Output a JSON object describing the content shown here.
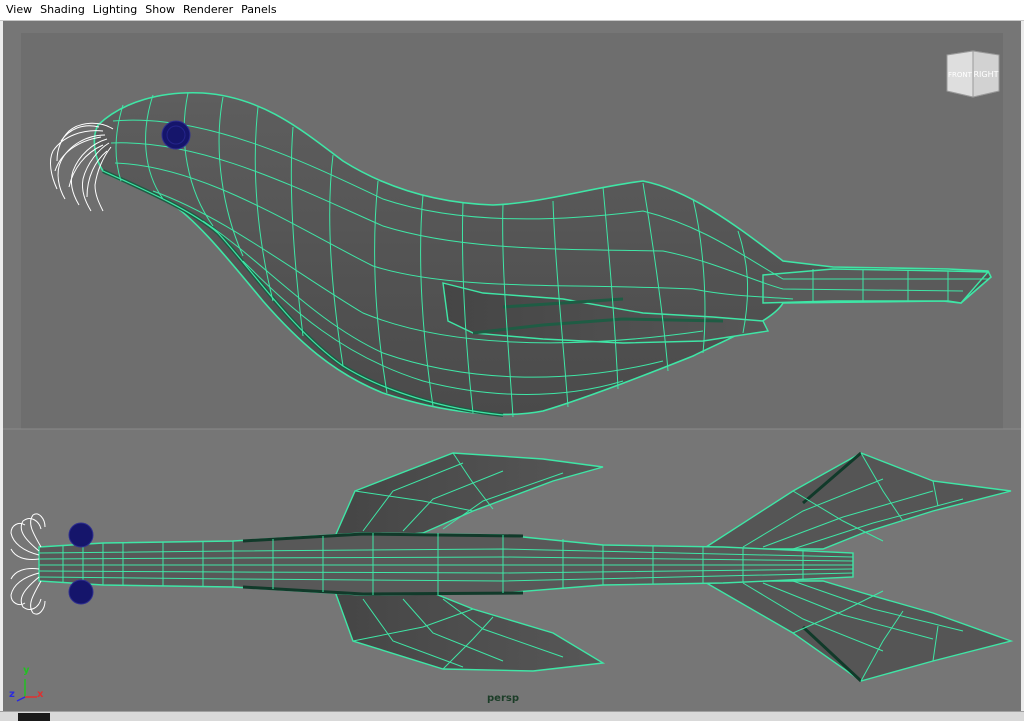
{
  "menu": {
    "items": [
      "View",
      "Shading",
      "Lighting",
      "Show",
      "Renderer",
      "Panels"
    ]
  },
  "viewcube": {
    "front_label": "FRONT",
    "right_label": "RIGHT"
  },
  "viewport": {
    "camera_label": "persp",
    "background_color": "#767676",
    "wire_color": "#3fe6a6",
    "eye_color": "#15156b"
  },
  "axis": {
    "x_label": "x",
    "y_label": "y",
    "z_label": "z",
    "x_color": "#e03030",
    "y_color": "#22c022",
    "z_color": "#2a2ae0"
  }
}
